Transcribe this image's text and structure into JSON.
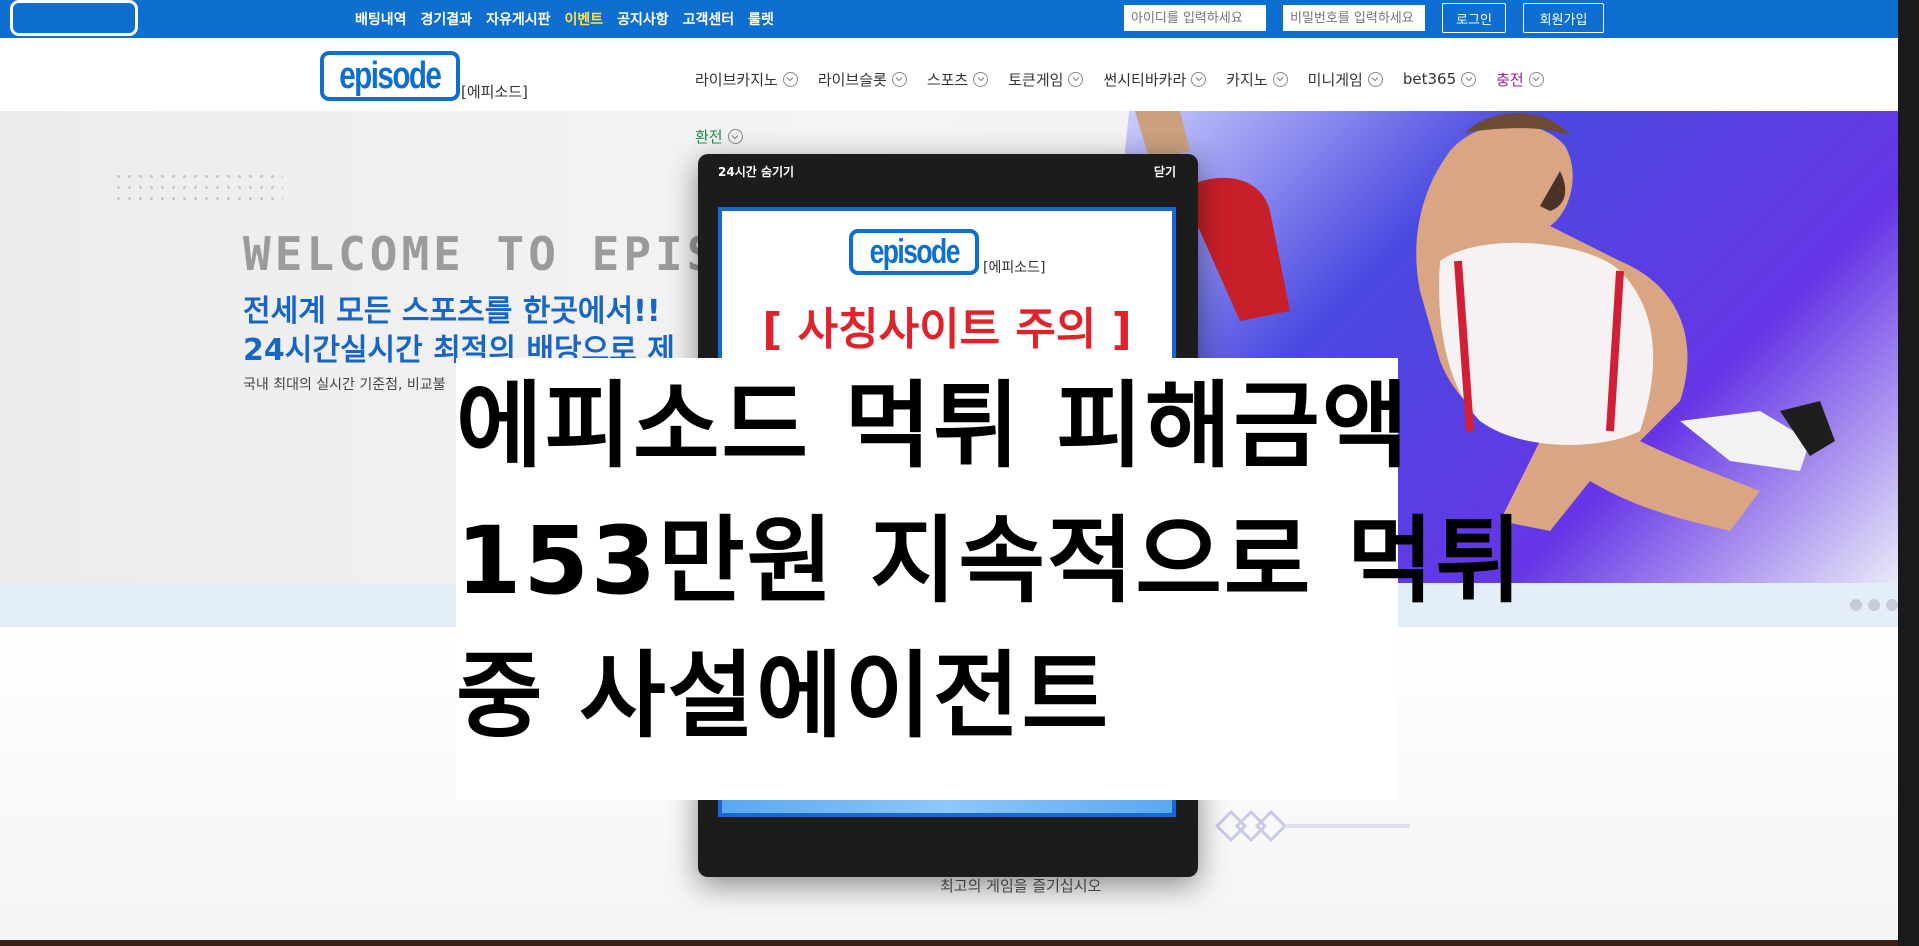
{
  "top_bar": {
    "menu": [
      "배팅내역",
      "경기결과",
      "자유게시판",
      "이벤트",
      "공지사항",
      "고객센터",
      "룰렛"
    ],
    "highlight_index": 3,
    "id_placeholder": "아이디를 입력하세요",
    "pw_placeholder": "비밀번호를 입력하세요",
    "login_label": "로그인",
    "signup_label": "회원가입"
  },
  "nav": {
    "logo_text": "episode",
    "logo_sub": "[에피소드]",
    "items": [
      "라이브카지노",
      "라이브슬롯",
      "스포츠",
      "토큰게임",
      "썬시티바카라",
      "카지노",
      "미니게임",
      "bet365",
      "충전"
    ],
    "exchange": "환전"
  },
  "hero": {
    "welcome": "WELCOME TO EPISO",
    "line1": "전세계 모든 스포츠를 한곳에서!!",
    "line2": "24시간실시간 최적의 배당으로 제",
    "sub": "국내 최대의 실시간 기준점, 비교불"
  },
  "popup": {
    "hide_24h": "24시간 숨기기",
    "close": "닫기",
    "logo_text": "episode",
    "logo_sub": "[에피소드]",
    "warning": "[ 사칭사이트 주의 ]"
  },
  "overlay": {
    "line1": "에피소드 먹튀 피해금액",
    "line2": "153만원 지속적으로 먹튀",
    "line3": "중 사설에이전트"
  },
  "caption": "최고의 게임을 즐기십시오",
  "colors": {
    "brand_blue": "#0f6fd1",
    "event_yellow": "#ffe14a",
    "warning_red": "#e0222a",
    "charge_purple": "#9a1f9a",
    "exchange_green": "#1f8f4a"
  },
  "icons": {
    "nav_dropdown": "chevron-down-icon",
    "band": [
      "circle-icon",
      "circle-icon",
      "circle-icon"
    ],
    "divider": "diamond-chain-icon"
  }
}
